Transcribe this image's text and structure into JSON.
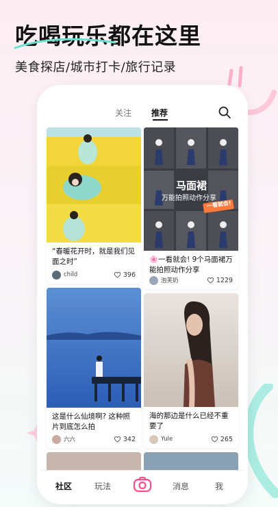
{
  "hero": {
    "title": "吃喝玩乐都在这里",
    "subtitle": "美食探店/城市打卡/旅行记录"
  },
  "app": {
    "tabs": [
      {
        "label": "关注",
        "active": false
      },
      {
        "label": "推荐",
        "active": true
      }
    ],
    "search_icon": "search-icon",
    "feed": [
      {
        "title": "“春暖花开时，就是我们见面之时”",
        "author": "child",
        "likes": "396"
      },
      {
        "title": "🌸一看就会! 9个马面裙万能拍照动作分享",
        "author": "泡芙奶",
        "likes": "1229",
        "overlay": {
          "line1": "马面裙",
          "line2": "万能拍照动作分享",
          "badge": "一看就会!"
        }
      },
      {
        "title": "这是什么仙境啊? 这种照片到底怎么拍",
        "author": "六六",
        "likes": "342"
      },
      {
        "title": "海的那边是什么已经不重要了",
        "author": "Yule",
        "likes": "265"
      }
    ],
    "bottom_nav": {
      "community": "社区",
      "play": "玩法",
      "camera_icon": "camera-icon",
      "messages": "消息",
      "me": "我"
    }
  },
  "colors": {
    "accent_pink": "#ff4f86",
    "accent_mint": "#63d8c8"
  }
}
